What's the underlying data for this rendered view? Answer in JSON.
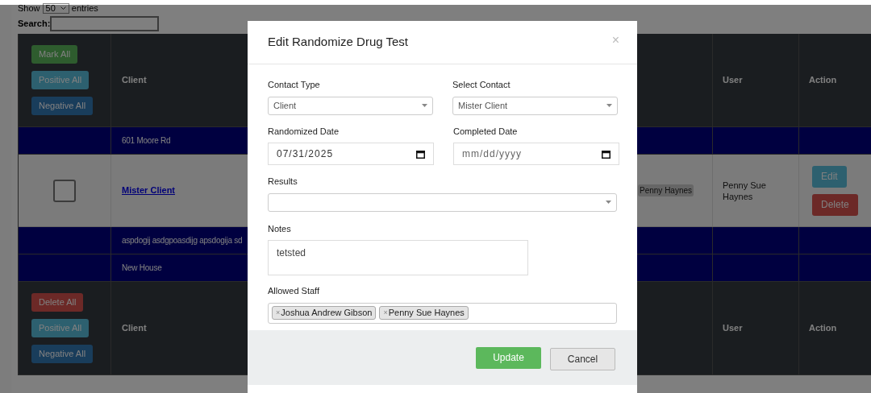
{
  "page": {
    "show_label": "Show",
    "page_size": "50",
    "entries_label": "entries",
    "search_label": "Search:"
  },
  "table": {
    "header": {
      "buttons": [
        {
          "label": "Mark All",
          "kind": "success"
        },
        {
          "label": "Positive All",
          "kind": "info"
        },
        {
          "label": "Negative All",
          "kind": "primary"
        }
      ],
      "columns": [
        "Client",
        "User",
        "Action"
      ]
    },
    "rows": [
      {
        "kind": "group",
        "title": "601 Moore Rd"
      },
      {
        "kind": "record",
        "checked": false,
        "client": "Mister Client",
        "staff": "Penny Haynes",
        "user": "Penny Sue Haynes",
        "actions": [
          {
            "label": "Edit",
            "kind": "info"
          },
          {
            "label": "Delete",
            "kind": "danger"
          }
        ]
      },
      {
        "kind": "group",
        "title": "aspdogij asdgpoasdijg apsdogija sd"
      },
      {
        "kind": "group",
        "title": "New House"
      }
    ],
    "footer": {
      "buttons": [
        {
          "label": "Delete All",
          "kind": "danger"
        },
        {
          "label": "Positive All",
          "kind": "info"
        },
        {
          "label": "Negative All",
          "kind": "primary"
        }
      ],
      "columns": [
        "Client",
        "User",
        "Action"
      ]
    }
  },
  "modal": {
    "title": "Edit Randomize Drug Test",
    "close": "×",
    "contact_type": {
      "label": "Contact Type",
      "value": "Client"
    },
    "select_contact": {
      "label": "Select Contact",
      "value": "Mister Client"
    },
    "randomized_date": {
      "label": "Randomized Date",
      "value": "07/31/2025"
    },
    "completed_date": {
      "label": "Completed Date",
      "placeholder": "mm/dd/yyyy"
    },
    "results": {
      "label": "Results"
    },
    "notes": {
      "label": "Notes",
      "value": "tetsted"
    },
    "allowed_staff": {
      "label": "Allowed Staff",
      "tags": [
        {
          "name": "Joshua Andrew Gibson",
          "remove": "×"
        },
        {
          "name": "Penny Sue Haynes",
          "remove": "×"
        }
      ]
    },
    "buttons": [
      {
        "label": "Update",
        "kind": "primary"
      },
      {
        "label": "Cancel",
        "kind": "secondary"
      }
    ]
  }
}
